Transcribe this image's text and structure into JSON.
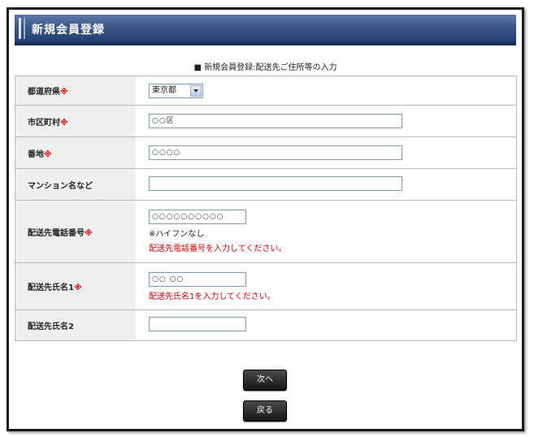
{
  "header": {
    "title": "新規会員登録"
  },
  "section_caption": "■ 新規会員登録:配送先ご住所等の入力",
  "required_mark": "※",
  "fields": {
    "prefecture": {
      "label": "都道府県",
      "value": "東京都"
    },
    "city": {
      "label": "市区町村",
      "value": "○○区"
    },
    "street": {
      "label": "番地",
      "value": "○○○○"
    },
    "building": {
      "label": "マンション名など",
      "value": ""
    },
    "phone": {
      "label": "配送先電話番号",
      "value": "○○○○○○○○○○",
      "note": "※ハイフンなし",
      "error": "配送先電話番号を入力してください。"
    },
    "name1": {
      "label": "配送先氏名1",
      "value": "○○ ○○",
      "error": "配送先氏名1を入力してください。"
    },
    "name2": {
      "label": "配送先氏名2",
      "value": ""
    }
  },
  "buttons": {
    "next": "次へ",
    "back": "戻る"
  },
  "colors": {
    "required": "#e00000",
    "error": "#d40000",
    "header_bg": "#2b4a80"
  }
}
